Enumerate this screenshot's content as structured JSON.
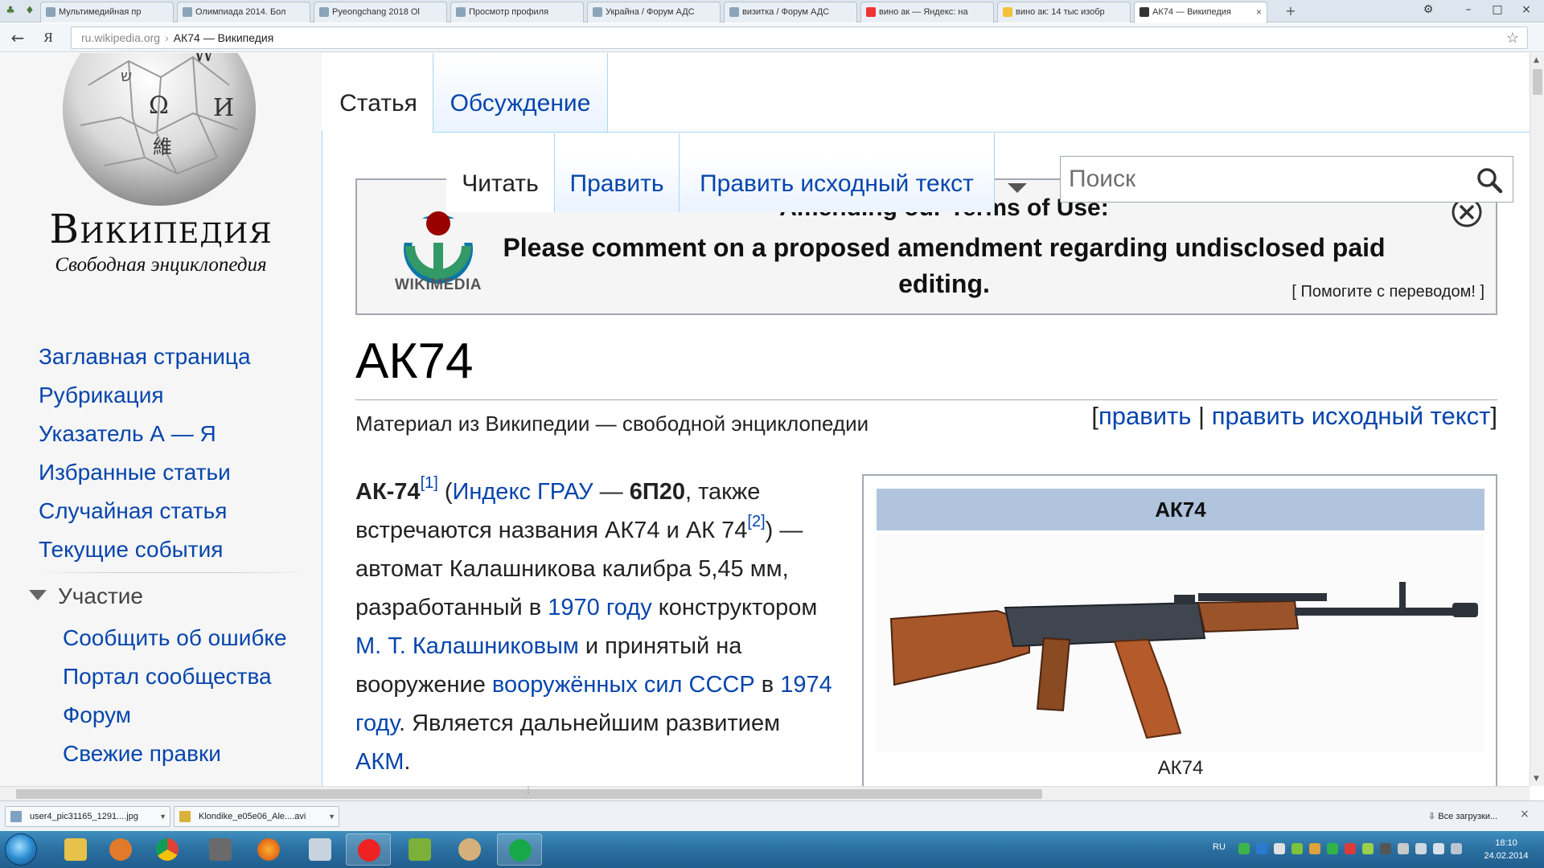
{
  "browser": {
    "tabs": [
      {
        "label": "Мультимедийная пр"
      },
      {
        "label": "Олимпиада 2014. Бол"
      },
      {
        "label": "Pyeongchang 2018 Ol"
      },
      {
        "label": "Просмотр профиля"
      },
      {
        "label": "Украйна / Форум АДС"
      },
      {
        "label": "визитка / Форум АДС"
      },
      {
        "label": "вино ак — Яндекс: на"
      },
      {
        "label": "вино ак: 14 тыс изобр"
      },
      {
        "label": "АК74 — Википедия"
      }
    ],
    "yandex_button": "Я",
    "url_domain": "ru.wikipedia.org",
    "url_title": "АК74 — Википедия"
  },
  "wiki": {
    "wordmark": "Википедия",
    "tagline": "Свободная энциклопедия",
    "nav": [
      "Заглавная страница",
      "Рубрикация",
      "Указатель А — Я",
      "Избранные статьи",
      "Случайная статья",
      "Текущие события"
    ],
    "participation_heading": "Участие",
    "participation": [
      "Сообщить об ошибке",
      "Портал сообщества",
      "Форум",
      "Свежие правки"
    ],
    "ns_tabs": {
      "article": "Статья",
      "talk": "Обсуждение"
    },
    "view_tabs": {
      "read": "Читать",
      "edit": "Править",
      "edit_source": "Править исходный текст"
    },
    "search_placeholder": "Поиск",
    "banner": {
      "logo_text": "WIKIMEDIA",
      "title": "Amending our Terms of Use:",
      "message": "Please comment on a proposed amendment regarding undisclosed paid editing.",
      "translate": "[ Помогите с переводом! ]"
    },
    "heading": "АК74",
    "site_sub": "Материал из Википедии — свободной энциклопедии",
    "edit_links": {
      "open": "[",
      "edit": "править",
      "sep": "|",
      "edit_source": "править исходный текст",
      "close": "]"
    },
    "body": {
      "term": "АК-74",
      "ref1": "[1]",
      "t1": " (",
      "gru_link": "Индекс ГРАУ",
      "t2": " — ",
      "gru_code": "6П20",
      "t3": ", также встречаются названия АК74 и АК 74",
      "ref2": "[2]",
      "t4": ") — автомат Калашникова калибра 5,45 мм, разработанный в ",
      "year1970": "1970 году",
      "t5": " конструктором ",
      "kalashnikov": "М. Т. Калашниковым",
      "t6": " и принятый на вооружение ",
      "ussr_forces": "вооружённых сил СССР",
      "t7": " в ",
      "year1974": "1974 году",
      "t8": ". Является дальнейшим развитием ",
      "akm": "АКМ",
      "t9": "."
    },
    "infobox": {
      "title": "АК74",
      "caption": "АК74"
    }
  },
  "downloads": {
    "items": [
      {
        "label": "user4_pic31165_1291....jpg"
      },
      {
        "label": "Klondike_e05e06_Ale....avi"
      }
    ],
    "all_label": "Все загрузки..."
  },
  "taskbar": {
    "lang": "RU",
    "time": "18:10",
    "date": "24.02.2014"
  }
}
